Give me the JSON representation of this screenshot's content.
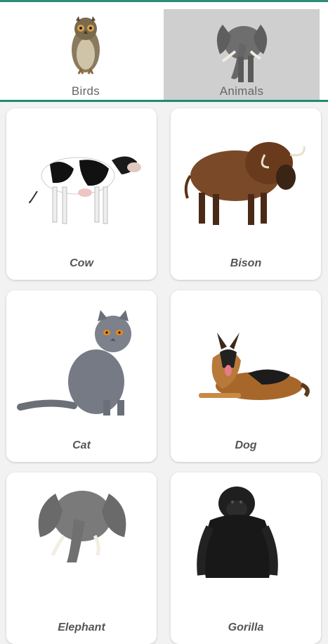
{
  "tabs": [
    {
      "label": "Birds",
      "icon": "owl-icon",
      "selected": false
    },
    {
      "label": "Animals",
      "icon": "elephant-icon",
      "selected": true
    }
  ],
  "colors": {
    "accent": "#1f8a72",
    "selected_tab_bg": "#cfcfcf"
  },
  "cards": [
    {
      "name": "Cow",
      "icon": "cow-image"
    },
    {
      "name": "Bison",
      "icon": "bison-image"
    },
    {
      "name": "Cat",
      "icon": "cat-image"
    },
    {
      "name": "Dog",
      "icon": "dog-image"
    },
    {
      "name": "Elephant",
      "icon": "elephant-image"
    },
    {
      "name": "Gorilla",
      "icon": "gorilla-image"
    }
  ]
}
